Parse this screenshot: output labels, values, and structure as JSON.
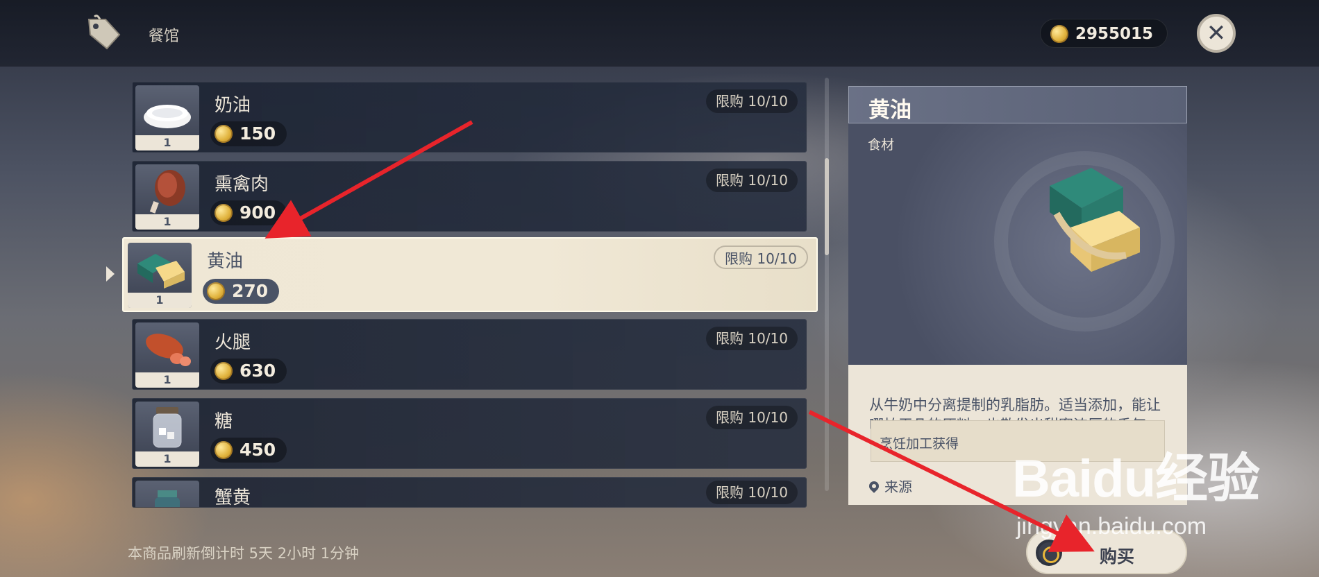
{
  "header": {
    "shop_title": "餐馆",
    "currency_amount": "2955015"
  },
  "items": [
    {
      "name": "奶油",
      "price": "150",
      "qty": "1",
      "limit": "限购 10/10",
      "icon": "cream-bowl-icon"
    },
    {
      "name": "熏禽肉",
      "price": "900",
      "qty": "1",
      "limit": "限购 10/10",
      "icon": "smoked-poultry-icon"
    },
    {
      "name": "黄油",
      "price": "270",
      "qty": "1",
      "limit": "限购 10/10",
      "icon": "butter-icon"
    },
    {
      "name": "火腿",
      "price": "630",
      "qty": "1",
      "limit": "限购 10/10",
      "icon": "ham-icon"
    },
    {
      "name": "糖",
      "price": "450",
      "qty": "1",
      "limit": "限购 10/10",
      "icon": "sugar-jar-icon"
    },
    {
      "name": "蟹黄",
      "price": "",
      "qty": "",
      "limit": "限购 10/10",
      "icon": "crab-roe-jar-icon"
    }
  ],
  "refresh_text": "本商品刷新倒计时 5天 2小时 1分钟",
  "detail": {
    "name": "黄油",
    "category": "食材",
    "description": "从牛奶中分离提制的乳脂肪。适当添加，能让哪怕平凡的原料，也散发出甜蜜浓厚的香气。",
    "source_label": "来源",
    "source_value": "烹饪加工获得"
  },
  "buy_label": "购买",
  "watermark": {
    "main": "Baidu经验",
    "sub": "jingyan.baidu.com"
  },
  "colors": {
    "annotation_arrow": "#e8242b",
    "coin": "#e0b23c",
    "panel_cream": "#ece5d8",
    "row_dark": "#1e2534"
  }
}
